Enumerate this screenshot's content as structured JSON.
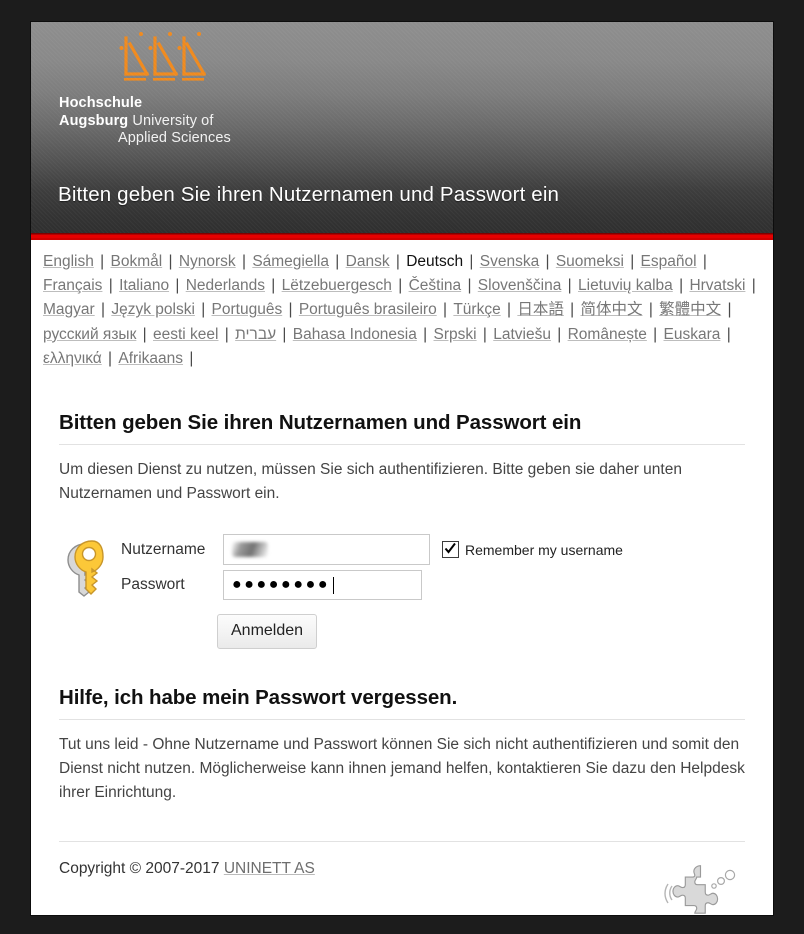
{
  "brand": {
    "line1": "Hochschule",
    "line2_bold": "Augsburg",
    "line2_rest": " University of",
    "line3": "Applied Sciences",
    "logo_icon": "hochschule-augsburg-logo-icon",
    "accent_color": "#f08a1e",
    "header_title": "Bitten geben Sie ihren Nutzernamen und Passwort ein",
    "rule_color": "#e50000"
  },
  "languages": [
    {
      "label": "English",
      "active": false
    },
    {
      "label": "Bokmål",
      "active": false
    },
    {
      "label": "Nynorsk",
      "active": false
    },
    {
      "label": "Sámegiella",
      "active": false
    },
    {
      "label": "Dansk",
      "active": false
    },
    {
      "label": "Deutsch",
      "active": true
    },
    {
      "label": "Svenska",
      "active": false
    },
    {
      "label": "Suomeksi",
      "active": false
    },
    {
      "label": "Español",
      "active": false
    },
    {
      "label": "Français",
      "active": false
    },
    {
      "label": "Italiano",
      "active": false
    },
    {
      "label": "Nederlands",
      "active": false
    },
    {
      "label": "Lëtzebuergesch",
      "active": false
    },
    {
      "label": "Čeština",
      "active": false
    },
    {
      "label": "Slovenščina",
      "active": false
    },
    {
      "label": "Lietuvių kalba",
      "active": false
    },
    {
      "label": "Hrvatski",
      "active": false
    },
    {
      "label": "Magyar",
      "active": false
    },
    {
      "label": "Język polski",
      "active": false
    },
    {
      "label": "Português",
      "active": false
    },
    {
      "label": "Português brasileiro",
      "active": false
    },
    {
      "label": "Türkçe",
      "active": false
    },
    {
      "label": "日本語",
      "active": false
    },
    {
      "label": "简体中文",
      "active": false
    },
    {
      "label": "繁體中文",
      "active": false
    },
    {
      "label": "русский язык",
      "active": false
    },
    {
      "label": "eesti keel",
      "active": false
    },
    {
      "label": "עברית",
      "active": false
    },
    {
      "label": "Bahasa Indonesia",
      "active": false
    },
    {
      "label": "Srpski",
      "active": false
    },
    {
      "label": "Latviešu",
      "active": false
    },
    {
      "label": "Românește",
      "active": false
    },
    {
      "label": "Euskara",
      "active": false
    },
    {
      "label": "ελληνικά",
      "active": false
    },
    {
      "label": "Afrikaans",
      "active": false
    }
  ],
  "login": {
    "heading": "Bitten geben Sie ihren Nutzernamen und Passwort ein",
    "intro": "Um diesen Dienst zu nutzen, müssen Sie sich authentifizieren. Bitte geben sie daher unten Nutzernamen und Passwort ein.",
    "key_icon": "key-icon",
    "username_label": "Nutzername",
    "username_value": "",
    "password_label": "Passwort",
    "password_masked": "●●●●●●●●",
    "remember_label": "Remember my username",
    "remember_checked": true,
    "submit_label": "Anmelden"
  },
  "help": {
    "heading": "Hilfe, ich habe mein Passwort vergessen.",
    "body": "Tut uns leid - Ohne Nutzername und Passwort können Sie sich nicht authentifizieren und somit den Dienst nicht nutzen. Möglicherweise kann ihnen jemand helfen, kontaktieren Sie dazu den Helpdesk ihrer Einrichtung."
  },
  "footer": {
    "copyright_text": "Copyright © 2007-2017 ",
    "copyright_link": "UNINETT AS",
    "logo_icon": "simplesamlphp-puzzle-man-icon"
  }
}
